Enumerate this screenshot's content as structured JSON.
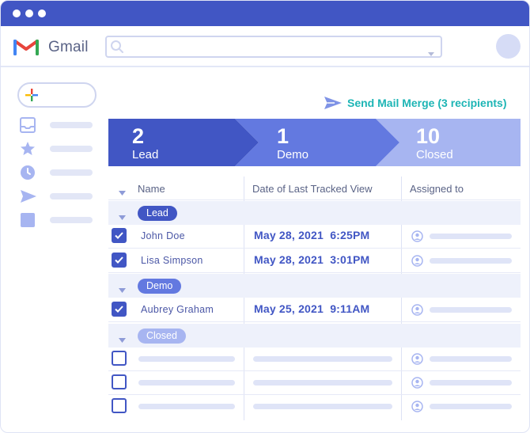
{
  "app": {
    "name": "Gmail"
  },
  "search": {
    "placeholder": ""
  },
  "toolbar": {
    "send_mail_merge_label": "Send Mail Merge (3 recipients)"
  },
  "stages": [
    {
      "count": "2",
      "label": "Lead"
    },
    {
      "count": "1",
      "label": "Demo"
    },
    {
      "count": "10",
      "label": "Closed"
    }
  ],
  "table": {
    "columns": [
      "Name",
      "Date of Last Tracked View",
      "Assigned to"
    ],
    "groups": [
      {
        "label": "Lead",
        "rows": [
          {
            "checked": true,
            "name": "John Doe",
            "date": "May 28, 2021  6:25PM"
          },
          {
            "checked": true,
            "name": "Lisa Simpson",
            "date": "May 28, 2021  3:01PM"
          }
        ]
      },
      {
        "label": "Demo",
        "rows": [
          {
            "checked": true,
            "name": "Aubrey Graham",
            "date": "May 25, 2021  9:11AM"
          }
        ]
      },
      {
        "label": "Closed",
        "rows": [
          {
            "checked": false,
            "name": "",
            "date": ""
          },
          {
            "checked": false,
            "name": "",
            "date": ""
          },
          {
            "checked": false,
            "name": "",
            "date": ""
          }
        ]
      }
    ]
  },
  "colors": {
    "brand": "#4156c4",
    "accent_teal": "#1db5b5",
    "stage_lead": "#4156c4",
    "stage_demo": "#6379e0",
    "stage_closed": "#a7b5f1"
  },
  "icons": [
    "gmail-logo-icon",
    "search-icon",
    "plus-icon",
    "inbox-icon",
    "star-icon",
    "clock-icon",
    "send-icon",
    "square-icon",
    "person-icon",
    "chevron-down-icon"
  ]
}
